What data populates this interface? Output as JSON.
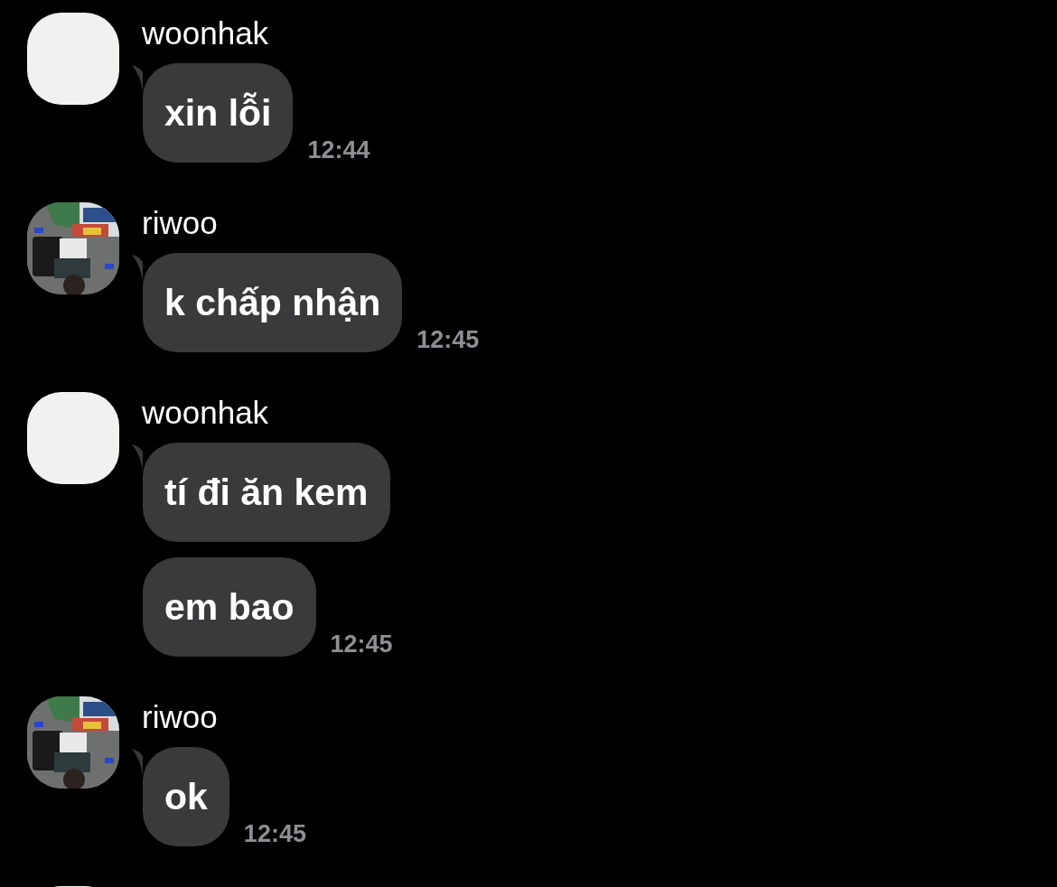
{
  "messages": [
    {
      "sender": "woonhak",
      "avatar": {
        "kind": "blob"
      },
      "bubbles": [
        {
          "text": "xin lỗi",
          "time": "12:44"
        }
      ]
    },
    {
      "sender": "riwoo",
      "avatar": {
        "kind": "picture"
      },
      "bubbles": [
        {
          "text": "k chấp nhận",
          "time": "12:45"
        }
      ]
    },
    {
      "sender": "woonhak",
      "avatar": {
        "kind": "blob"
      },
      "bubbles": [
        {
          "text": "tí đi ăn kem"
        },
        {
          "text": "em bao",
          "time": "12:45"
        }
      ]
    },
    {
      "sender": "riwoo",
      "avatar": {
        "kind": "picture"
      },
      "bubbles": [
        {
          "text": "ok",
          "time": "12:45"
        }
      ]
    },
    {
      "avatar": {
        "kind": "blob"
      }
    }
  ]
}
